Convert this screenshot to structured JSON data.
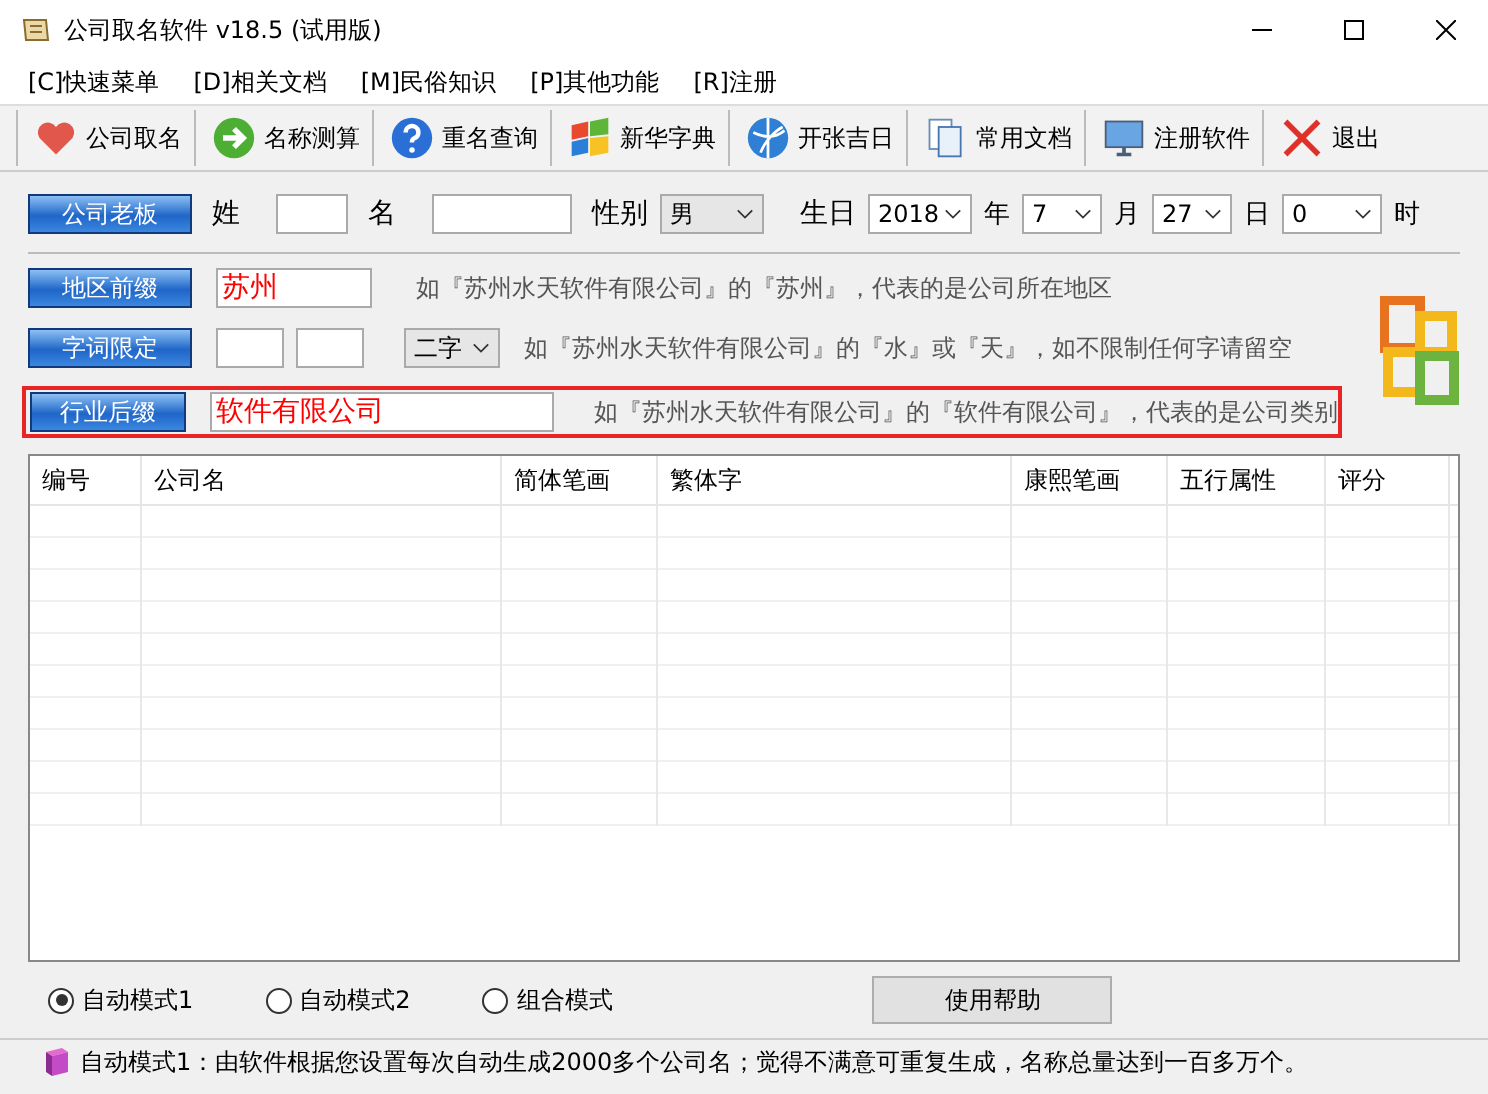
{
  "window": {
    "title": "公司取名软件 v18.5 (试用版)"
  },
  "menu": [
    "[C]快速菜单",
    "[D]相关文档",
    "[M]民俗知识",
    "[P]其他功能",
    "[R]注册"
  ],
  "toolbar": [
    {
      "kind": "heart",
      "label": "公司取名"
    },
    {
      "kind": "arrow",
      "label": "名称测算"
    },
    {
      "kind": "question",
      "label": "重名查询"
    },
    {
      "kind": "flag",
      "label": "新华字典"
    },
    {
      "kind": "globe",
      "label": "开张吉日"
    },
    {
      "kind": "docs",
      "label": "常用文档"
    },
    {
      "kind": "monitor",
      "label": "注册软件"
    },
    {
      "kind": "cross",
      "label": "退出"
    }
  ],
  "boss": {
    "button": "公司老板",
    "surname_label": "姓",
    "name_label": "名",
    "gender_label": "性别",
    "gender": "男",
    "birth_label": "生日",
    "year": "2018",
    "year_unit": "年",
    "month": "7",
    "month_unit": "月",
    "day": "27",
    "day_unit": "日",
    "hour": "0",
    "hour_unit": "时"
  },
  "prefix": {
    "button": "地区前缀",
    "value": "苏州",
    "hint": "如『苏州水天软件有限公司』的『苏州』，代表的是公司所在地区"
  },
  "limit": {
    "button": "字词限定",
    "length": "二字",
    "hint": "如『苏州水天软件有限公司』的『水』或『天』，如不限制任何字请留空"
  },
  "suffix": {
    "button": "行业后缀",
    "value": "软件有限公司",
    "hint": "如『苏州水天软件有限公司』的『软件有限公司』，代表的是公司类别",
    "highlighted": true
  },
  "table": {
    "columns": [
      "编号",
      "公司名",
      "简体笔画",
      "繁体字",
      "康熙笔画",
      "五行属性",
      "评分"
    ]
  },
  "modes": [
    {
      "label": "自动模式1",
      "selected": true
    },
    {
      "label": "自动模式2",
      "selected": false
    },
    {
      "label": "组合模式",
      "selected": false
    }
  ],
  "help_button": "使用帮助",
  "status_bar": "自动模式1：由软件根据您设置每次自动生成2000多个公司名；觉得不满意可重复生成，名称总量达到一百多万个。"
}
